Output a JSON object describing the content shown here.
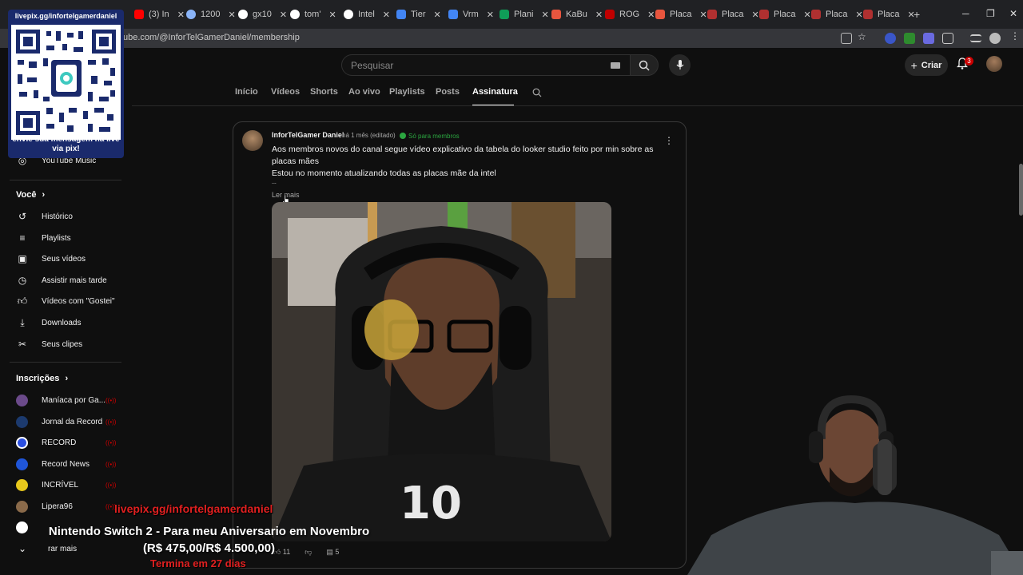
{
  "browser": {
    "tabs": [
      {
        "label": "(3) In",
        "color": "#ff0000"
      },
      {
        "label": "1200",
        "color": "#8ab4f8"
      },
      {
        "label": "gx10",
        "color": "#ffffff"
      },
      {
        "label": "tom'",
        "color": "#ffffff"
      },
      {
        "label": "Intel",
        "color": "#ffffff"
      },
      {
        "label": "Tier",
        "color": "#4285f4"
      },
      {
        "label": "Vrm",
        "color": "#4285f4"
      },
      {
        "label": "Plani",
        "color": "#0f9d58"
      },
      {
        "label": "KaBu",
        "color": "#e8553e"
      },
      {
        "label": "ROG",
        "color": "#c00000"
      },
      {
        "label": "Placa",
        "color": "#e8553e"
      },
      {
        "label": "Placa",
        "color": "#b03030"
      },
      {
        "label": "Placa",
        "color": "#b03030"
      },
      {
        "label": "Placa",
        "color": "#b03030"
      },
      {
        "label": "Placa",
        "color": "#b03030"
      }
    ],
    "new_tab": "+",
    "url": "ube.com/@InforTelGamerDaniel/membership"
  },
  "header": {
    "search_placeholder": "Pesquisar",
    "create_label": "Criar",
    "notification_count": "3"
  },
  "channel_tabs": [
    "Início",
    "Vídeos",
    "Shorts",
    "Ao vivo",
    "Playlists",
    "Posts",
    "Assinatura"
  ],
  "sidebar": {
    "music_item": "YouTube Music",
    "voce_heading": "Você",
    "voce_items": [
      "Histórico",
      "Playlists",
      "Seus vídeos",
      "Assistir mais tarde",
      "Vídeos com \"Gostei\"",
      "Downloads",
      "Seus clipes"
    ],
    "subs_heading": "Inscrições",
    "subs": [
      {
        "name": "Maníaca por Ga...",
        "color": "#6b4a8a"
      },
      {
        "name": "Jornal da Record",
        "color": "#1c3a6e"
      },
      {
        "name": "RECORD",
        "color": "#2b4fe0"
      },
      {
        "name": "Record News",
        "color": "#1f55d8"
      },
      {
        "name": "INCRÍVEL",
        "color": "#e8c81c"
      },
      {
        "name": "Lipera96",
        "color": "#8a6a4a"
      }
    ],
    "more_label": "rar mais"
  },
  "qr_overlay": {
    "title": "livepix.gg/infortelgamerdaniel",
    "caption": "envie sua mensagem na live via pix!"
  },
  "post": {
    "author": "InforTelGamer Daniel",
    "time": "há 1 mês (editado)",
    "badge": "Só para membros",
    "lines": [
      "Aos membros novos do canal segue vídeo explicativo da tabela do looker studio feito por min sobre as placas mães",
      "Estou no momento atualizando todas as placas mãe da intel",
      "..."
    ],
    "read_more": "Ler mais",
    "jersey_number": "10",
    "likes": "11",
    "comments": "5"
  },
  "stream_overlay": {
    "url": "livepix.gg/infortelgamerdaniel",
    "goal_line1": "Nintendo Switch 2 - Para meu Aniversario em Novembro",
    "goal_line2": "(R$ 475,00/R$ 4.500,00)",
    "time_left": "Termina em 27 dias"
  }
}
